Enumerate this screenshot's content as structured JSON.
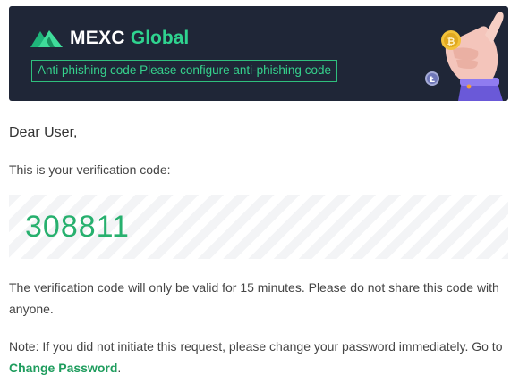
{
  "banner": {
    "brand_name": "MEXC",
    "brand_sub": "Global",
    "anti_phishing_text": "Anti phishing code Please configure anti-phishing code",
    "logo_icon": "mexc-mountain-logo",
    "illustration": "hand-holding-coin-icon"
  },
  "email": {
    "greeting": "Dear User,",
    "intro": "This is your verification code:",
    "code": "308811",
    "validity_text": "The verification code will only be valid for 15 minutes. Please do not share this code with anyone.",
    "note_text": "Note: If you did not initiate this request, please change your password immediately. Go to ",
    "change_password_link": "Change Password",
    "note_end": "."
  },
  "colors": {
    "accent": "#2fd38f",
    "banner_bg": "#1f2637",
    "code_color": "#27b06e",
    "link_color": "#1f9d5e"
  }
}
